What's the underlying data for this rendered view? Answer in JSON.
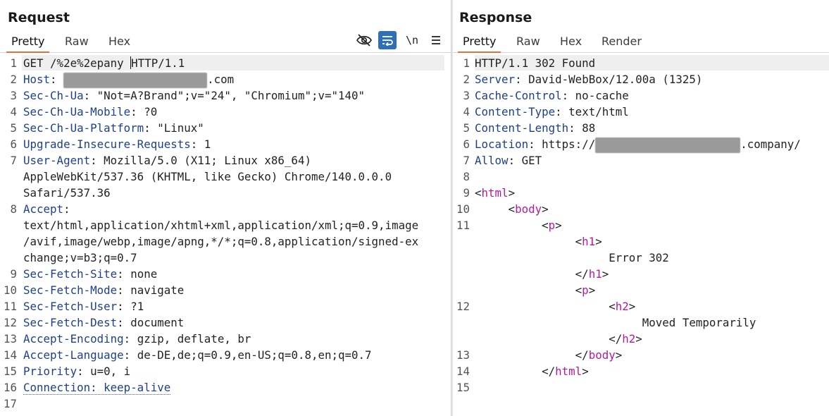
{
  "request": {
    "title": "Request",
    "tabs": [
      "Pretty",
      "Raw",
      "Hex"
    ],
    "active_tab": "Pretty",
    "toolbar": {
      "newline_label": "\\n"
    },
    "lines": [
      {
        "n": "1",
        "parts": [
          {
            "t": "GET /%2e%2epany ",
            "c": "val"
          },
          {
            "caret": true
          },
          {
            "t": "HTTP/1.1",
            "c": "val"
          }
        ],
        "highlight": true
      },
      {
        "n": "2",
        "parts": [
          {
            "t": "Host",
            "c": "hkey"
          },
          {
            "t": ": ",
            "c": "sep"
          },
          {
            "redact": true,
            "w": 204
          },
          {
            "t": ".com",
            "c": "val"
          }
        ]
      },
      {
        "n": "3",
        "parts": [
          {
            "t": "Sec-Ch-Ua",
            "c": "hkey"
          },
          {
            "t": ": ",
            "c": "sep"
          },
          {
            "t": "\"Not=A?Brand\";v=\"24\", \"Chromium\";v=\"140\"",
            "c": "val"
          }
        ]
      },
      {
        "n": "4",
        "parts": [
          {
            "t": "Sec-Ch-Ua-Mobile",
            "c": "hkey"
          },
          {
            "t": ": ",
            "c": "sep"
          },
          {
            "t": "?0",
            "c": "val"
          }
        ]
      },
      {
        "n": "5",
        "parts": [
          {
            "t": "Sec-Ch-Ua-Platform",
            "c": "hkey"
          },
          {
            "t": ": ",
            "c": "sep"
          },
          {
            "t": "\"Linux\"",
            "c": "val"
          }
        ]
      },
      {
        "n": "6",
        "parts": [
          {
            "t": "Upgrade-Insecure-Requests",
            "c": "hkey"
          },
          {
            "t": ": ",
            "c": "sep"
          },
          {
            "t": "1",
            "c": "val"
          }
        ]
      },
      {
        "n": "7",
        "parts": [
          {
            "t": "User-Agent",
            "c": "hkey"
          },
          {
            "t": ": ",
            "c": "sep"
          },
          {
            "t": "Mozilla/5.0 (X11; Linux x86_64)",
            "c": "val"
          }
        ]
      },
      {
        "n": "",
        "parts": [
          {
            "t": "AppleWebKit/537.36 (KHTML, like Gecko) Chrome/140.0.0.0",
            "c": "val"
          }
        ]
      },
      {
        "n": "",
        "parts": [
          {
            "t": "Safari/537.36",
            "c": "val"
          }
        ]
      },
      {
        "n": "8",
        "parts": [
          {
            "t": "Accept",
            "c": "hkey"
          },
          {
            "t": ":",
            "c": "sep"
          }
        ]
      },
      {
        "n": "",
        "parts": [
          {
            "t": "text/html,application/xhtml+xml,application/xml;q=0.9,image",
            "c": "val"
          }
        ]
      },
      {
        "n": "",
        "parts": [
          {
            "t": "/avif,image/webp,image/apng,*/*;q=0.8,application/signed-ex",
            "c": "val"
          }
        ]
      },
      {
        "n": "",
        "parts": [
          {
            "t": "change;v=b3;q=0.7",
            "c": "val"
          }
        ]
      },
      {
        "n": "9",
        "parts": [
          {
            "t": "Sec-Fetch-Site",
            "c": "hkey"
          },
          {
            "t": ": ",
            "c": "sep"
          },
          {
            "t": "none",
            "c": "val"
          }
        ]
      },
      {
        "n": "10",
        "parts": [
          {
            "t": "Sec-Fetch-Mode",
            "c": "hkey"
          },
          {
            "t": ": ",
            "c": "sep"
          },
          {
            "t": "navigate",
            "c": "val"
          }
        ]
      },
      {
        "n": "11",
        "parts": [
          {
            "t": "Sec-Fetch-User",
            "c": "hkey"
          },
          {
            "t": ": ",
            "c": "sep"
          },
          {
            "t": "?1",
            "c": "val"
          }
        ]
      },
      {
        "n": "12",
        "parts": [
          {
            "t": "Sec-Fetch-Dest",
            "c": "hkey"
          },
          {
            "t": ": ",
            "c": "sep"
          },
          {
            "t": "document",
            "c": "val"
          }
        ]
      },
      {
        "n": "13",
        "parts": [
          {
            "t": "Accept-Encoding",
            "c": "hkey"
          },
          {
            "t": ": ",
            "c": "sep"
          },
          {
            "t": "gzip, deflate, br",
            "c": "val"
          }
        ]
      },
      {
        "n": "14",
        "parts": [
          {
            "t": "Accept-Language",
            "c": "hkey"
          },
          {
            "t": ": ",
            "c": "sep"
          },
          {
            "t": "de-DE,de;q=0.9,en-US;q=0.8,en;q=0.7",
            "c": "val"
          }
        ]
      },
      {
        "n": "15",
        "parts": [
          {
            "t": "Priority",
            "c": "hkey"
          },
          {
            "t": ": ",
            "c": "sep"
          },
          {
            "t": "u=0, i",
            "c": "val"
          }
        ]
      },
      {
        "n": "16",
        "parts": [
          {
            "t": "Connection: keep-alive",
            "c": "hkey dotted"
          }
        ]
      },
      {
        "n": "17",
        "parts": []
      }
    ]
  },
  "response": {
    "title": "Response",
    "tabs": [
      "Pretty",
      "Raw",
      "Hex",
      "Render"
    ],
    "active_tab": "Pretty",
    "lines": [
      {
        "n": "1",
        "parts": [
          {
            "t": "HTTP/1.1 302 Found",
            "c": "val"
          }
        ],
        "highlight": true
      },
      {
        "n": "2",
        "parts": [
          {
            "t": "Server",
            "c": "hkey"
          },
          {
            "t": ": ",
            "c": "sep"
          },
          {
            "t": "David-WebBox/12.00a (1325)",
            "c": "val"
          }
        ]
      },
      {
        "n": "3",
        "parts": [
          {
            "t": "Cache-Control",
            "c": "hkey"
          },
          {
            "t": ": ",
            "c": "sep"
          },
          {
            "t": "no-cache",
            "c": "val"
          }
        ]
      },
      {
        "n": "4",
        "parts": [
          {
            "t": "Content-Type",
            "c": "hkey"
          },
          {
            "t": ": ",
            "c": "sep"
          },
          {
            "t": "text/html",
            "c": "val"
          }
        ]
      },
      {
        "n": "5",
        "parts": [
          {
            "t": "Content-Length",
            "c": "hkey"
          },
          {
            "t": ": ",
            "c": "sep"
          },
          {
            "t": "88",
            "c": "val"
          }
        ]
      },
      {
        "n": "6",
        "parts": [
          {
            "t": "Location",
            "c": "hkey"
          },
          {
            "t": ": ",
            "c": "sep"
          },
          {
            "t": "https://",
            "c": "val"
          },
          {
            "redact": true,
            "w": 206
          },
          {
            "t": ".company/",
            "c": "val"
          }
        ]
      },
      {
        "n": "7",
        "parts": [
          {
            "t": "Allow",
            "c": "hkey"
          },
          {
            "t": ": ",
            "c": "sep"
          },
          {
            "t": "GET",
            "c": "val"
          }
        ]
      },
      {
        "n": "8",
        "parts": []
      },
      {
        "n": "9",
        "parts": [
          {
            "t": "<",
            "c": "punc"
          },
          {
            "t": "html",
            "c": "tagc"
          },
          {
            "t": ">",
            "c": "punc"
          }
        ]
      },
      {
        "n": "10",
        "parts": [
          {
            "t": "     <",
            "c": "punc"
          },
          {
            "t": "body",
            "c": "tagc"
          },
          {
            "t": ">",
            "c": "punc"
          }
        ]
      },
      {
        "n": "11",
        "parts": [
          {
            "t": "          <",
            "c": "punc"
          },
          {
            "t": "p",
            "c": "tagc"
          },
          {
            "t": ">",
            "c": "punc"
          }
        ]
      },
      {
        "n": "",
        "parts": [
          {
            "t": "               <",
            "c": "punc"
          },
          {
            "t": "h1",
            "c": "tagc"
          },
          {
            "t": ">",
            "c": "punc"
          }
        ]
      },
      {
        "n": "",
        "parts": [
          {
            "t": "                    Error 302",
            "c": "val"
          }
        ]
      },
      {
        "n": "",
        "parts": [
          {
            "t": "               </",
            "c": "punc"
          },
          {
            "t": "h1",
            "c": "tagc"
          },
          {
            "t": ">",
            "c": "punc"
          }
        ]
      },
      {
        "n": "",
        "parts": [
          {
            "t": "               <",
            "c": "punc"
          },
          {
            "t": "p",
            "c": "tagc"
          },
          {
            "t": ">",
            "c": "punc"
          }
        ]
      },
      {
        "n": "12",
        "parts": [
          {
            "t": "                    <",
            "c": "punc"
          },
          {
            "t": "h2",
            "c": "tagc"
          },
          {
            "t": ">",
            "c": "punc"
          }
        ]
      },
      {
        "n": "",
        "parts": [
          {
            "t": "                         Moved Temporarily",
            "c": "val"
          }
        ]
      },
      {
        "n": "",
        "parts": [
          {
            "t": "                    </",
            "c": "punc"
          },
          {
            "t": "h2",
            "c": "tagc"
          },
          {
            "t": ">",
            "c": "punc"
          }
        ]
      },
      {
        "n": "13",
        "parts": [
          {
            "t": "               </",
            "c": "punc"
          },
          {
            "t": "body",
            "c": "tagc"
          },
          {
            "t": ">",
            "c": "punc"
          }
        ]
      },
      {
        "n": "14",
        "parts": [
          {
            "t": "          </",
            "c": "punc"
          },
          {
            "t": "html",
            "c": "tagc"
          },
          {
            "t": ">",
            "c": "punc"
          }
        ]
      },
      {
        "n": "15",
        "parts": []
      }
    ]
  }
}
